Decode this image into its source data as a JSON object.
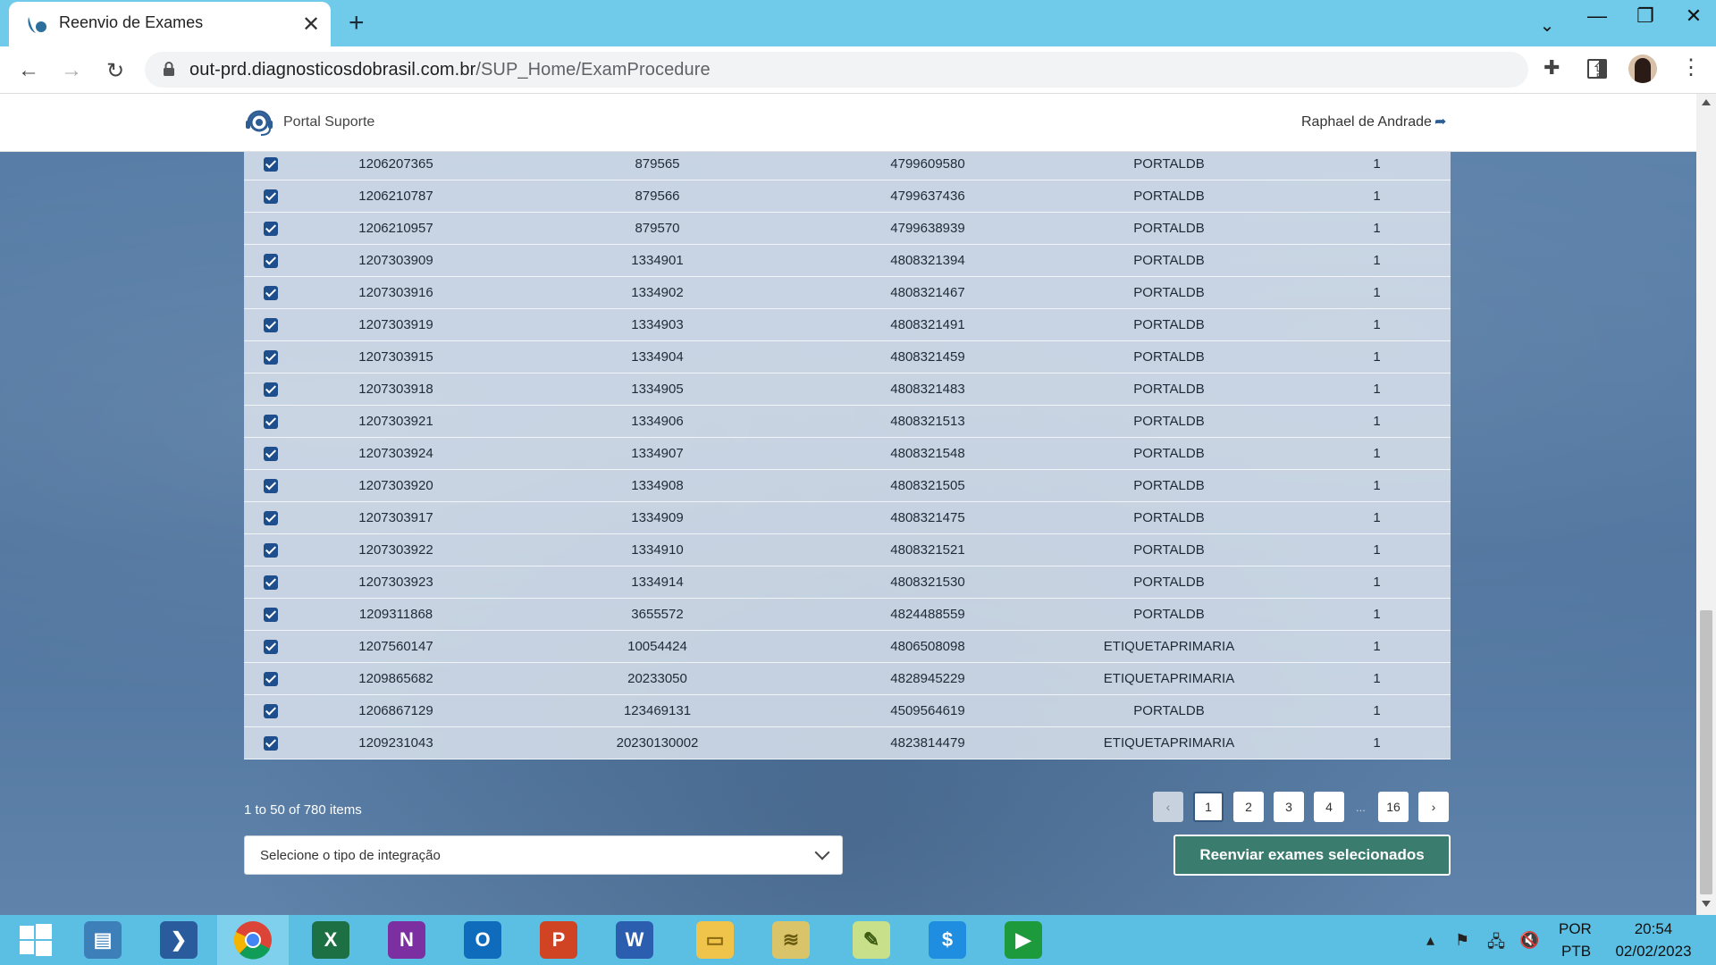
{
  "browser": {
    "tab_title": "Reenvio de Exames",
    "url_domain": "out-prd.diagnosticosdobrasil.com.br",
    "url_path": "/SUP_Home/ExamProcedure"
  },
  "header": {
    "brand": "Portal Suporte",
    "user": "Raphael de Andrade"
  },
  "table": {
    "rows": [
      {
        "c1": "1206207365",
        "c2": "879565",
        "c3": "4799609580",
        "c4": "PORTALDB",
        "c5": "1"
      },
      {
        "c1": "1206210787",
        "c2": "879566",
        "c3": "4799637436",
        "c4": "PORTALDB",
        "c5": "1"
      },
      {
        "c1": "1206210957",
        "c2": "879570",
        "c3": "4799638939",
        "c4": "PORTALDB",
        "c5": "1"
      },
      {
        "c1": "1207303909",
        "c2": "1334901",
        "c3": "4808321394",
        "c4": "PORTALDB",
        "c5": "1"
      },
      {
        "c1": "1207303916",
        "c2": "1334902",
        "c3": "4808321467",
        "c4": "PORTALDB",
        "c5": "1"
      },
      {
        "c1": "1207303919",
        "c2": "1334903",
        "c3": "4808321491",
        "c4": "PORTALDB",
        "c5": "1"
      },
      {
        "c1": "1207303915",
        "c2": "1334904",
        "c3": "4808321459",
        "c4": "PORTALDB",
        "c5": "1"
      },
      {
        "c1": "1207303918",
        "c2": "1334905",
        "c3": "4808321483",
        "c4": "PORTALDB",
        "c5": "1"
      },
      {
        "c1": "1207303921",
        "c2": "1334906",
        "c3": "4808321513",
        "c4": "PORTALDB",
        "c5": "1"
      },
      {
        "c1": "1207303924",
        "c2": "1334907",
        "c3": "4808321548",
        "c4": "PORTALDB",
        "c5": "1"
      },
      {
        "c1": "1207303920",
        "c2": "1334908",
        "c3": "4808321505",
        "c4": "PORTALDB",
        "c5": "1"
      },
      {
        "c1": "1207303917",
        "c2": "1334909",
        "c3": "4808321475",
        "c4": "PORTALDB",
        "c5": "1"
      },
      {
        "c1": "1207303922",
        "c2": "1334910",
        "c3": "4808321521",
        "c4": "PORTALDB",
        "c5": "1"
      },
      {
        "c1": "1207303923",
        "c2": "1334914",
        "c3": "4808321530",
        "c4": "PORTALDB",
        "c5": "1"
      },
      {
        "c1": "1209311868",
        "c2": "3655572",
        "c3": "4824488559",
        "c4": "PORTALDB",
        "c5": "1"
      },
      {
        "c1": "1207560147",
        "c2": "10054424",
        "c3": "4806508098",
        "c4": "ETIQUETAPRIMARIA",
        "c5": "1"
      },
      {
        "c1": "1209865682",
        "c2": "20233050",
        "c3": "4828945229",
        "c4": "ETIQUETAPRIMARIA",
        "c5": "1"
      },
      {
        "c1": "1206867129",
        "c2": "123469131",
        "c3": "4509564619",
        "c4": "PORTALDB",
        "c5": "1"
      },
      {
        "c1": "1209231043",
        "c2": "20230130002",
        "c3": "4823814479",
        "c4": "ETIQUETAPRIMARIA",
        "c5": "1"
      }
    ]
  },
  "pagination": {
    "info": "1 to 50 of 780 items",
    "prev": "‹",
    "pages": [
      "1",
      "2",
      "3",
      "4"
    ],
    "ellipsis": "...",
    "last": "16",
    "next": "›",
    "current": "1"
  },
  "controls": {
    "select_placeholder": "Selecione o tipo de integração",
    "resend_button": "Reenviar exames selecionados"
  },
  "taskbar": {
    "lang_top": "POR",
    "lang_bottom": "PTB",
    "time": "20:54",
    "date": "02/02/2023"
  },
  "colors": {
    "accent_button": "#3a7c6d",
    "checkbox": "#1e4e8c",
    "tabstrip": "#6fcbe9",
    "taskbar": "#5bbfe3"
  }
}
